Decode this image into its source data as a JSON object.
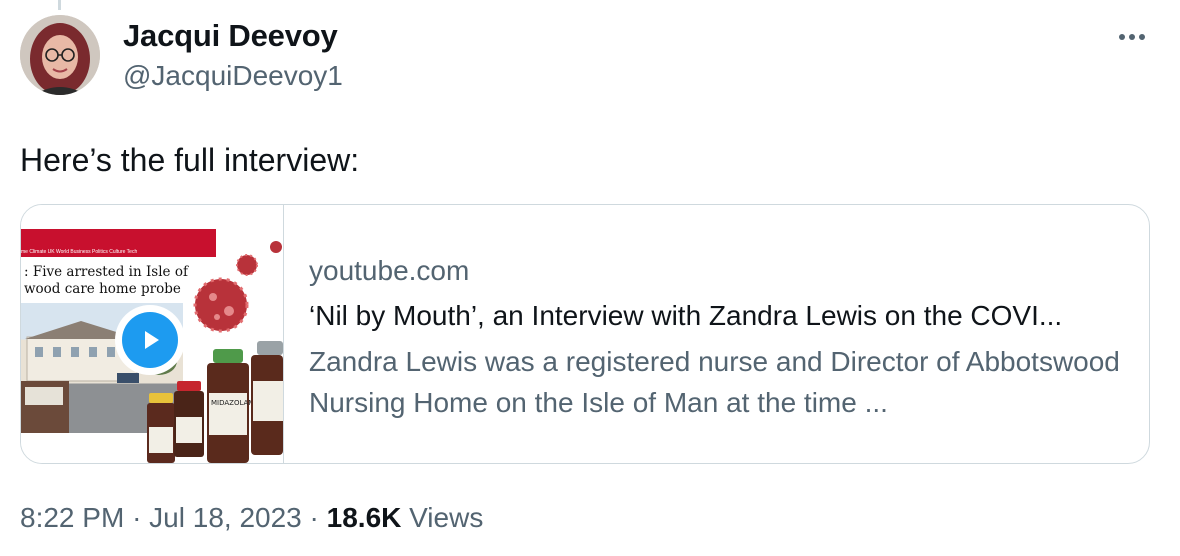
{
  "author": {
    "name": "Jacqui Deevoy",
    "handle": "@JacquiDeevoy1"
  },
  "tweet": {
    "text": "Here’s the full interview:"
  },
  "card": {
    "domain": "youtube.com",
    "title": "‘Nil by Mouth’, an Interview with Zandra Lewis on the COVI...",
    "description": "Zandra Lewis was a registered nurse and Director of Abbotswood Nursing Home on the Isle of Man at the time ...",
    "thumbnail": {
      "nav_text": "me  Climate  UK  World  Business  Politics  Culture  Tech",
      "headline_line1": ": Five arrested in Isle of",
      "headline_line2": "wood care home probe",
      "vial_label": "MIDAZOLAM"
    }
  },
  "meta": {
    "time": "8:22 PM",
    "separator": "·",
    "date": "Jul 18, 2023",
    "views_count": "18.6K",
    "views_label": "Views"
  },
  "icons": {
    "more": "more-options-icon",
    "play": "play-icon"
  },
  "colors": {
    "accent": "#1d9bf0",
    "secondary_text": "#536471",
    "border": "#cfd9de",
    "news_red": "#c8102e"
  }
}
